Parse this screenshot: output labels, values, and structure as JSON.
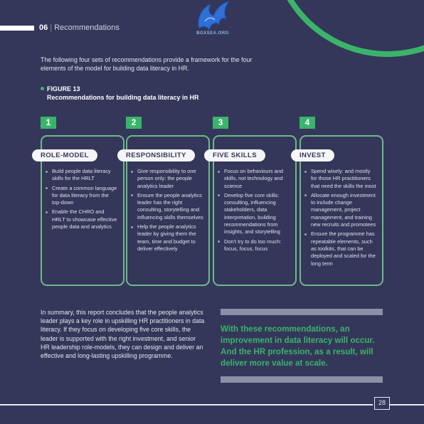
{
  "header": {
    "section_number": "06",
    "section_title": "Recommendations"
  },
  "logo": {
    "text": "BOXSEA.ORG"
  },
  "intro": "The following four sets of recommendations provide a framework for the four elements of the model for building data literacy in HR.",
  "figure": {
    "label": "FIGURE 13",
    "title": "Recommendations for building data literacy in HR"
  },
  "columns": [
    {
      "number": "1",
      "heading": "ROLE-MODEL",
      "items": [
        "Build people data literacy skills for the HRLT",
        "Create a common language for data literacy from the top-down",
        "Enable the CHRO and HRLT to showcase effective people data and analytics"
      ]
    },
    {
      "number": "2",
      "heading": "RESPONSIBILITY",
      "items": [
        "Give responsibility to one person only: the people analytics leader",
        "Ensure the people analytics leader has the right consulting, storytelling and influencing skills themselves",
        "Help the people analytics leader by giving them the team, time and budget to deliver effectively"
      ]
    },
    {
      "number": "3",
      "heading": "FIVE SKILLS",
      "items": [
        "Focus on behaviours and skills, not technology and science",
        "Develop five core skills: consulting, influencing stakeholders, data interpretation, building recommendations from insights, and storytelling",
        "Don't try to do too much: focus, focus, focus"
      ]
    },
    {
      "number": "4",
      "heading": "INVEST",
      "items": [
        "Spend wisely: and mostly for those HR practitioners that need the skills the most",
        "Allocate enough investment to include change management, project management, and training new recruits and promotees",
        "Ensure the programme has repeatable elements, such as toolkits, that can be deployed and scaled for the long term"
      ]
    }
  ],
  "summary": "In summary, this report concludes that the people analytics leader plays a key role in upskilling HR practitioners in data literacy. If they focus on developing five core skills, the leader is supported with the right investment, and senior HR leadership role-models, they can design and deliver an effective and long-lasting upskilling programme.",
  "quote": "With these recommendations, an improvement in data literacy will occur. And the HR profession, as a result, will deliver more value at scale.",
  "page_number": "28",
  "colors": {
    "background": "#34375a",
    "accent": "#3bb46b",
    "card_border": "#6fb98a"
  }
}
